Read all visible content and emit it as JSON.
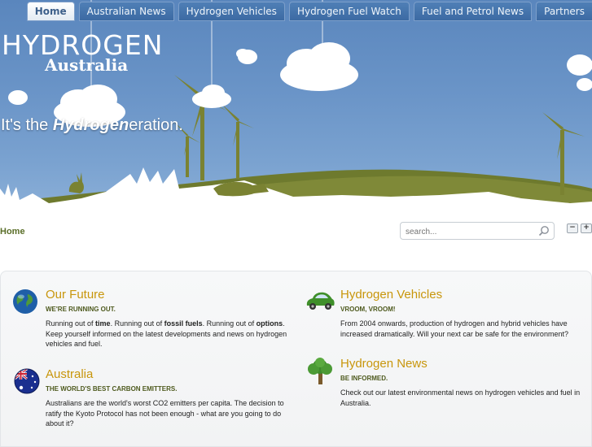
{
  "nav": {
    "items": [
      "Home",
      "Australian News",
      "Hydrogen Vehicles",
      "Hydrogen Fuel Watch",
      "Fuel and Petrol News",
      "Partners"
    ],
    "active": "Home"
  },
  "logo": {
    "word": "HYDROGEN",
    "sub": "Australia"
  },
  "tagline": {
    "prefix": "It's the ",
    "emphasis": "Hydrogen",
    "suffix": "eration."
  },
  "breadcrumb": "Home",
  "search": {
    "placeholder": "search...",
    "value": "search..."
  },
  "font_size_controls": {
    "decrease": "−",
    "increase": "+"
  },
  "blocks": {
    "our_future": {
      "title": "Our Future",
      "subtitle": "WE'RE RUNNING OUT.",
      "text_parts": [
        "Running out of ",
        "time",
        ". Running out of ",
        "fossil fuels",
        ". Running out of ",
        "options",
        ". Keep yourself informed on the latest developments and news on hydrogen vehicles and fuel."
      ]
    },
    "hydrogen_vehicles": {
      "title": "Hydrogen Vehicles",
      "subtitle": "VROOM, VROOM!",
      "text": "From 2004 onwards, production of hydrogen and hybrid vehicles have increased dramatically. Will your next car be safe for the environment?"
    },
    "australia": {
      "title": "Australia",
      "subtitle": "THE WORLD'S BEST CARBON EMITTERS.",
      "text": "Australians are the world's worst CO2 emitters per capita. The decision to ratify the Kyoto Protocol has not been enough - what are you going to do about it?"
    },
    "hydrogen_news": {
      "title": "Hydrogen News",
      "subtitle": "BE INFORMED.",
      "text": "Check out our latest environmental news on hydrogen vehicles and fuel in Australia."
    }
  },
  "colors": {
    "sky": "#6b95c8",
    "hill": "#6e7a2e",
    "title_accent": "#c8960c",
    "subtitle": "#4e5a1e"
  }
}
